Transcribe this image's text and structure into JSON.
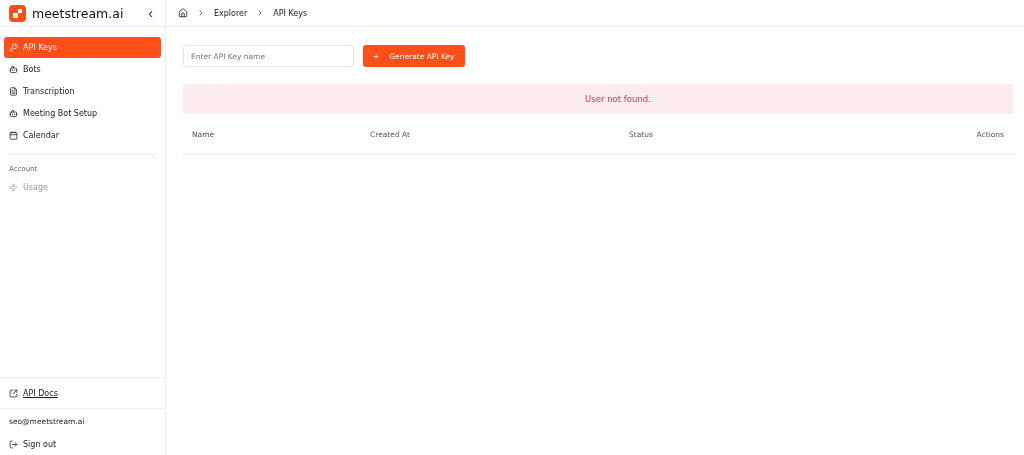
{
  "brand": {
    "name": "meetstream.ai",
    "collapse": "‹"
  },
  "nav": [
    {
      "label": "API Keys",
      "kind": "key",
      "selected": true
    },
    {
      "label": "Bots",
      "kind": "bot",
      "selected": false
    },
    {
      "label": "Transcription",
      "kind": "doc",
      "selected": false
    },
    {
      "label": "Meeting Bot Setup",
      "kind": "bot",
      "selected": false
    },
    {
      "label": "Calendar",
      "kind": "calendar",
      "selected": false
    }
  ],
  "account": {
    "heading": "Account",
    "items": [
      {
        "label": "Usage",
        "kind": "zap",
        "disabled": true
      }
    ]
  },
  "docs_link": "API Docs",
  "user_email": "seo@meetstream.ai",
  "sign_out": "Sign out",
  "breadcrumbs": [
    "Explorer",
    "API Keys"
  ],
  "key_name_field": {
    "placeholder": "Enter API Key name"
  },
  "generate_button": {
    "icon": "+",
    "label": "Generate API Key"
  },
  "error_message": "User not found.",
  "table": {
    "columns": [
      "Name",
      "Created At",
      "Status",
      "Actions"
    ]
  }
}
